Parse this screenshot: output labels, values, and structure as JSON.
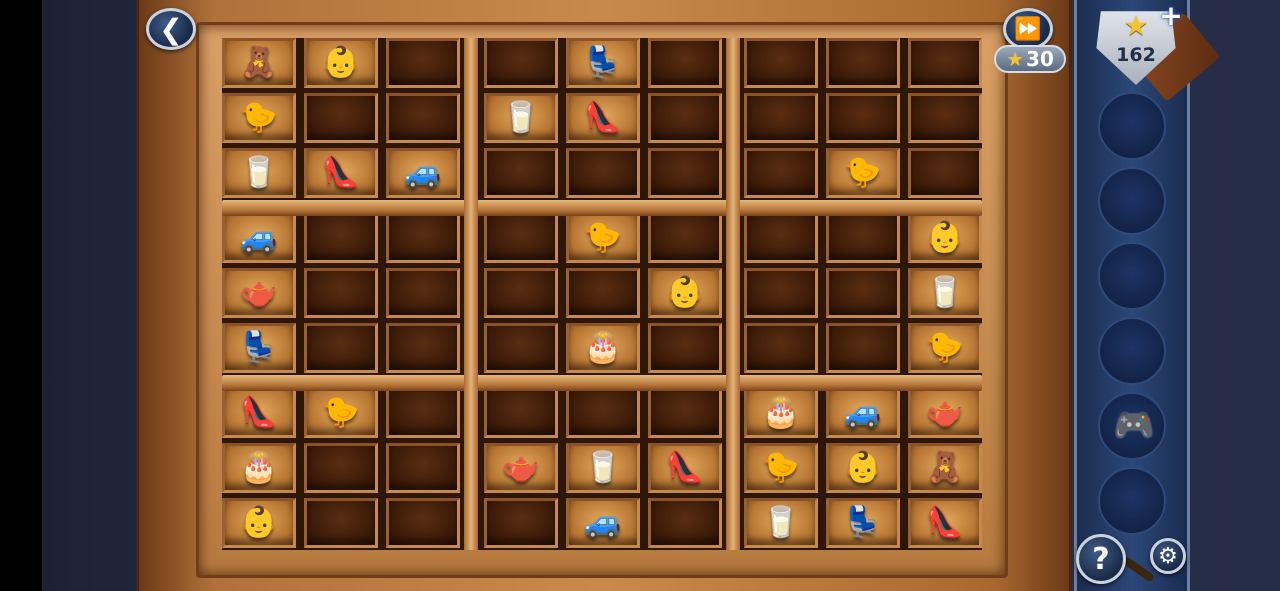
{
  "hud": {
    "back_icon": "chevron-left-icon",
    "skip_icon": "fast-forward-icon",
    "skip_cost": "30",
    "star_count": "162",
    "help_label": "?",
    "settings_icon": "gear-icon",
    "plus_label": "+"
  },
  "colors": {
    "wood_light": "#e3a95c",
    "wood_dark": "#3a1a08",
    "panel_blue": "#2c4878",
    "star_gold": "#f1c232"
  },
  "inventory": {
    "slot_count": 6,
    "items": [
      "",
      "",
      "",
      "",
      "gamepad",
      ""
    ]
  },
  "shelf": {
    "rows": 9,
    "cols": 9,
    "items": [
      {
        "row": 0,
        "col": 0,
        "kind": "teddy-bear",
        "glyph": "🧸"
      },
      {
        "row": 0,
        "col": 1,
        "kind": "doll",
        "glyph": "👶"
      },
      {
        "row": 0,
        "col": 4,
        "kind": "armchair",
        "glyph": "💺"
      },
      {
        "row": 1,
        "col": 0,
        "kind": "canary",
        "glyph": "🐤"
      },
      {
        "row": 1,
        "col": 3,
        "kind": "thimble",
        "glyph": "🥛"
      },
      {
        "row": 1,
        "col": 4,
        "kind": "high-heel",
        "glyph": "👠"
      },
      {
        "row": 2,
        "col": 0,
        "kind": "thimble",
        "glyph": "🥛"
      },
      {
        "row": 2,
        "col": 1,
        "kind": "high-heel",
        "glyph": "👠"
      },
      {
        "row": 2,
        "col": 2,
        "kind": "toy-car",
        "glyph": "🚙"
      },
      {
        "row": 2,
        "col": 7,
        "kind": "canary",
        "glyph": "🐤"
      },
      {
        "row": 3,
        "col": 0,
        "kind": "toy-car",
        "glyph": "🚙"
      },
      {
        "row": 3,
        "col": 4,
        "kind": "canary",
        "glyph": "🐤"
      },
      {
        "row": 3,
        "col": 8,
        "kind": "doll",
        "glyph": "👶"
      },
      {
        "row": 4,
        "col": 0,
        "kind": "teapot",
        "glyph": "🫖"
      },
      {
        "row": 4,
        "col": 5,
        "kind": "doll",
        "glyph": "👶"
      },
      {
        "row": 4,
        "col": 8,
        "kind": "thimble",
        "glyph": "🥛"
      },
      {
        "row": 5,
        "col": 0,
        "kind": "armchair",
        "glyph": "💺"
      },
      {
        "row": 5,
        "col": 4,
        "kind": "cake",
        "glyph": "🎂"
      },
      {
        "row": 5,
        "col": 8,
        "kind": "canary",
        "glyph": "🐤"
      },
      {
        "row": 6,
        "col": 0,
        "kind": "high-heel",
        "glyph": "👠"
      },
      {
        "row": 6,
        "col": 1,
        "kind": "canary",
        "glyph": "🐤"
      },
      {
        "row": 6,
        "col": 6,
        "kind": "cake",
        "glyph": "🎂"
      },
      {
        "row": 6,
        "col": 7,
        "kind": "toy-car",
        "glyph": "🚙"
      },
      {
        "row": 6,
        "col": 8,
        "kind": "teapot",
        "glyph": "🫖"
      },
      {
        "row": 7,
        "col": 0,
        "kind": "cake",
        "glyph": "🎂"
      },
      {
        "row": 7,
        "col": 3,
        "kind": "teapot",
        "glyph": "🫖"
      },
      {
        "row": 7,
        "col": 4,
        "kind": "thimble",
        "glyph": "🥛"
      },
      {
        "row": 7,
        "col": 5,
        "kind": "high-heel",
        "glyph": "👠"
      },
      {
        "row": 7,
        "col": 6,
        "kind": "canary",
        "glyph": "🐤"
      },
      {
        "row": 7,
        "col": 7,
        "kind": "doll",
        "glyph": "👶"
      },
      {
        "row": 7,
        "col": 8,
        "kind": "teddy-bear",
        "glyph": "🧸"
      },
      {
        "row": 8,
        "col": 0,
        "kind": "doll",
        "glyph": "👶"
      },
      {
        "row": 8,
        "col": 4,
        "kind": "toy-car",
        "glyph": "🚙"
      },
      {
        "row": 8,
        "col": 6,
        "kind": "thimble",
        "glyph": "🥛"
      },
      {
        "row": 8,
        "col": 7,
        "kind": "armchair",
        "glyph": "💺"
      },
      {
        "row": 8,
        "col": 8,
        "kind": "high-heel",
        "glyph": "👠"
      }
    ]
  }
}
